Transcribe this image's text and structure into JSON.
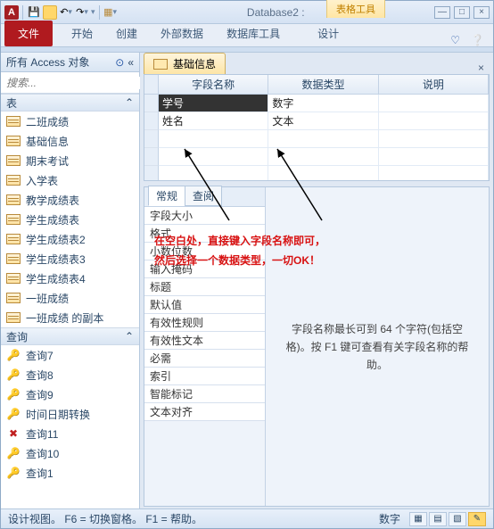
{
  "window": {
    "title": "Database2 :",
    "min": "—",
    "max": "□",
    "close": "×"
  },
  "ctx_label": "表格工具",
  "ribbon": {
    "file": "文件",
    "tabs": [
      "开始",
      "创建",
      "外部数据",
      "数据库工具"
    ],
    "ctx_tab": "设计"
  },
  "nav": {
    "header": "所有 Access 对象",
    "search_placeholder": "搜索...",
    "groups": [
      {
        "label": "表",
        "items": [
          "二班成绩",
          "基础信息",
          "期末考试",
          "入学表",
          "教学成绩表",
          "学生成绩表",
          "学生成绩表2",
          "学生成绩表3",
          "学生成绩表4",
          "一班成绩",
          "一班成绩 的副本"
        ]
      },
      {
        "label": "查询",
        "items": [
          {
            "label": "查询7",
            "icon": "q"
          },
          {
            "label": "查询8",
            "icon": "q"
          },
          {
            "label": "查询9",
            "icon": "q"
          },
          {
            "label": "时间日期转换",
            "icon": "q"
          },
          {
            "label": "查询11",
            "icon": "x"
          },
          {
            "label": "查询10",
            "icon": "q"
          },
          {
            "label": "查询1",
            "icon": "q"
          }
        ]
      }
    ]
  },
  "doc_tab": "基础信息",
  "grid": {
    "cols": [
      "字段名称",
      "数据类型",
      "说明"
    ],
    "rows": [
      [
        "学号",
        "数字",
        ""
      ],
      [
        "姓名",
        "文本",
        ""
      ]
    ]
  },
  "annotation": {
    "l1": "在空白处，直接键入字段名称即可，",
    "l2": "然后选择一个数据类型，一切OK！"
  },
  "props": {
    "tabs": [
      "常规",
      "查阅"
    ],
    "rows": [
      "字段大小",
      "格式",
      "小数位数",
      "输入掩码",
      "标题",
      "默认值",
      "有效性规则",
      "有效性文本",
      "必需",
      "索引",
      "智能标记",
      "文本对齐"
    ],
    "help": "字段名称最长可到 64 个字符(包括空格)。按 F1 键可查看有关字段名称的帮助。"
  },
  "status": {
    "left": "设计视图。  F6 = 切换窗格。   F1 = 帮助。",
    "ind": "数字"
  }
}
